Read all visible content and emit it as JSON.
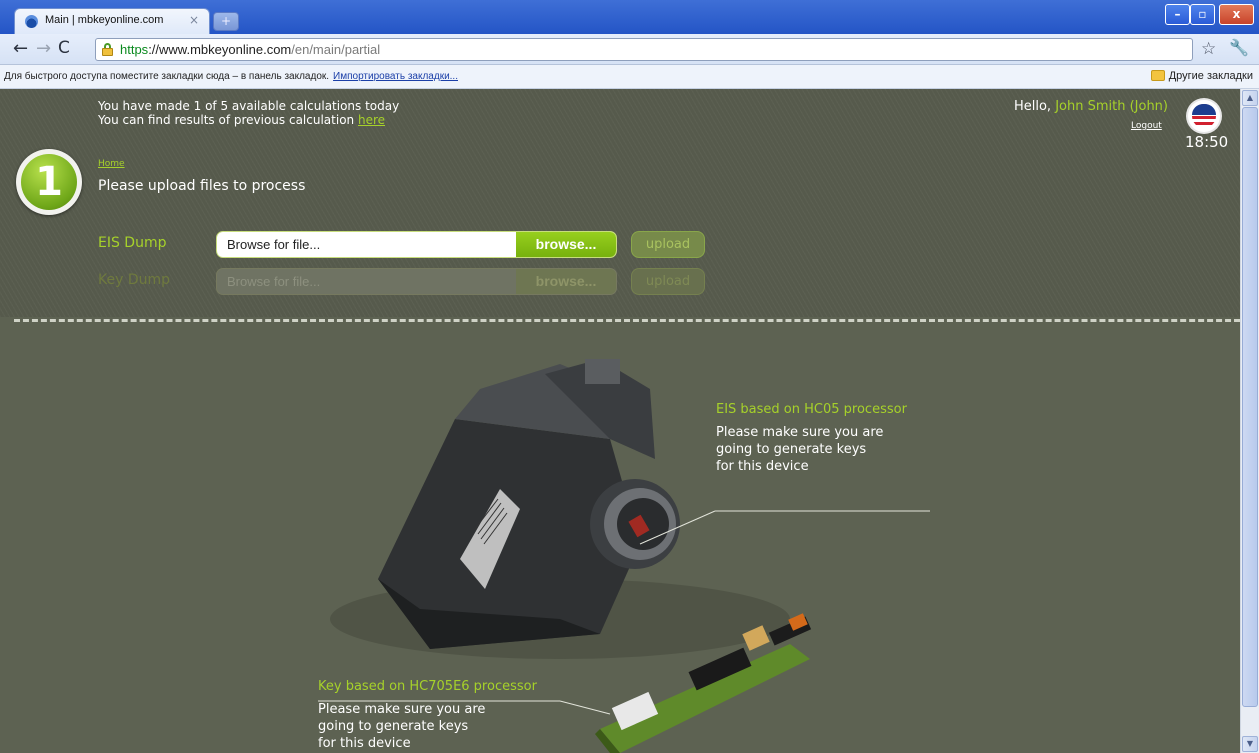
{
  "browser": {
    "tab_title": "Main | mbkeyonline.com",
    "tab_close": "×",
    "new_tab": "+",
    "win_min": "–",
    "win_max": "▫",
    "win_close": "x",
    "url_scheme": "https",
    "url_sep": "://",
    "url_host": "www.mbkeyonline.com",
    "url_path": "/en/main/partial",
    "bookmark_hint": "Для быстрого доступа поместите закладки сюда – в панель закладок.",
    "bookmark_import": "Импортировать закладки...",
    "bookmark_other": "Другие закладки"
  },
  "header": {
    "calc_line1": "You have made 1 of 5 available calculations today",
    "calc_line2_prefix": "You can find results of previous calculation ",
    "calc_line2_link": "here",
    "hello": "Hello, ",
    "user_name": "John Smith (John)",
    "logout": "Logout",
    "time": "18:50"
  },
  "step": {
    "number": "1",
    "breadcrumb": "Home",
    "title": "Please upload files to process"
  },
  "upload": {
    "rows": [
      {
        "label": "EIS Dump",
        "placeholder": "Browse for file...",
        "browse": "browse...",
        "upload": "upload",
        "enabled": true
      },
      {
        "label": "Key Dump",
        "placeholder": "Browse for file...",
        "browse": "browse...",
        "upload": "upload",
        "enabled": false
      }
    ]
  },
  "callouts": {
    "eis": {
      "title": "EIS based on HC05 processor",
      "line1": "Please make sure you are",
      "line2": "going to generate keys",
      "line3": "for this device"
    },
    "key": {
      "title": "Key based on HC705E6 processor",
      "line1": "Please make sure you are",
      "line2": "going to generate keys",
      "line3": "for this device"
    }
  },
  "colors": {
    "accent_green": "#a6d12a",
    "page_bg": "#5d6252"
  }
}
